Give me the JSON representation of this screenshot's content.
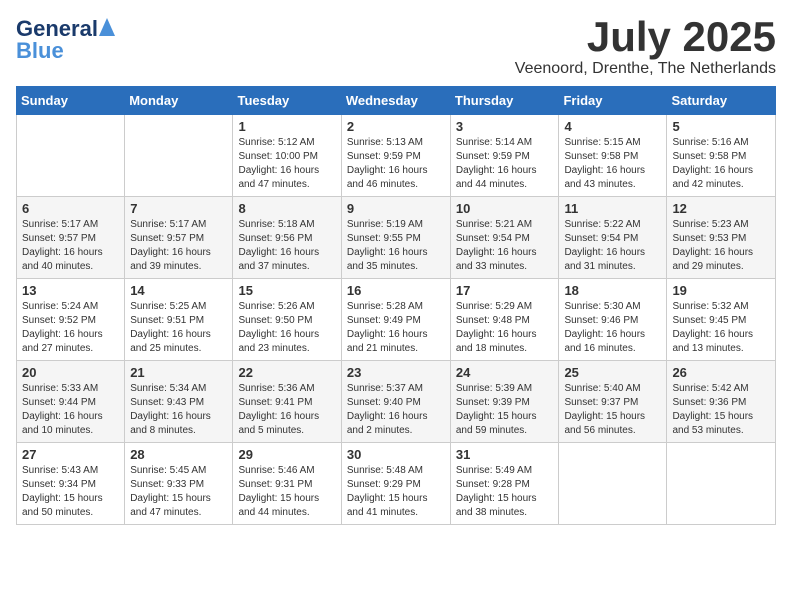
{
  "header": {
    "logo_general": "General",
    "logo_blue": "Blue",
    "month_title": "July 2025",
    "location": "Veenoord, Drenthe, The Netherlands"
  },
  "calendar": {
    "days_of_week": [
      "Sunday",
      "Monday",
      "Tuesday",
      "Wednesday",
      "Thursday",
      "Friday",
      "Saturday"
    ],
    "weeks": [
      [
        {
          "day": "",
          "info": ""
        },
        {
          "day": "",
          "info": ""
        },
        {
          "day": "1",
          "info": "Sunrise: 5:12 AM\nSunset: 10:00 PM\nDaylight: 16 hours\nand 47 minutes."
        },
        {
          "day": "2",
          "info": "Sunrise: 5:13 AM\nSunset: 9:59 PM\nDaylight: 16 hours\nand 46 minutes."
        },
        {
          "day": "3",
          "info": "Sunrise: 5:14 AM\nSunset: 9:59 PM\nDaylight: 16 hours\nand 44 minutes."
        },
        {
          "day": "4",
          "info": "Sunrise: 5:15 AM\nSunset: 9:58 PM\nDaylight: 16 hours\nand 43 minutes."
        },
        {
          "day": "5",
          "info": "Sunrise: 5:16 AM\nSunset: 9:58 PM\nDaylight: 16 hours\nand 42 minutes."
        }
      ],
      [
        {
          "day": "6",
          "info": "Sunrise: 5:17 AM\nSunset: 9:57 PM\nDaylight: 16 hours\nand 40 minutes."
        },
        {
          "day": "7",
          "info": "Sunrise: 5:17 AM\nSunset: 9:57 PM\nDaylight: 16 hours\nand 39 minutes."
        },
        {
          "day": "8",
          "info": "Sunrise: 5:18 AM\nSunset: 9:56 PM\nDaylight: 16 hours\nand 37 minutes."
        },
        {
          "day": "9",
          "info": "Sunrise: 5:19 AM\nSunset: 9:55 PM\nDaylight: 16 hours\nand 35 minutes."
        },
        {
          "day": "10",
          "info": "Sunrise: 5:21 AM\nSunset: 9:54 PM\nDaylight: 16 hours\nand 33 minutes."
        },
        {
          "day": "11",
          "info": "Sunrise: 5:22 AM\nSunset: 9:54 PM\nDaylight: 16 hours\nand 31 minutes."
        },
        {
          "day": "12",
          "info": "Sunrise: 5:23 AM\nSunset: 9:53 PM\nDaylight: 16 hours\nand 29 minutes."
        }
      ],
      [
        {
          "day": "13",
          "info": "Sunrise: 5:24 AM\nSunset: 9:52 PM\nDaylight: 16 hours\nand 27 minutes."
        },
        {
          "day": "14",
          "info": "Sunrise: 5:25 AM\nSunset: 9:51 PM\nDaylight: 16 hours\nand 25 minutes."
        },
        {
          "day": "15",
          "info": "Sunrise: 5:26 AM\nSunset: 9:50 PM\nDaylight: 16 hours\nand 23 minutes."
        },
        {
          "day": "16",
          "info": "Sunrise: 5:28 AM\nSunset: 9:49 PM\nDaylight: 16 hours\nand 21 minutes."
        },
        {
          "day": "17",
          "info": "Sunrise: 5:29 AM\nSunset: 9:48 PM\nDaylight: 16 hours\nand 18 minutes."
        },
        {
          "day": "18",
          "info": "Sunrise: 5:30 AM\nSunset: 9:46 PM\nDaylight: 16 hours\nand 16 minutes."
        },
        {
          "day": "19",
          "info": "Sunrise: 5:32 AM\nSunset: 9:45 PM\nDaylight: 16 hours\nand 13 minutes."
        }
      ],
      [
        {
          "day": "20",
          "info": "Sunrise: 5:33 AM\nSunset: 9:44 PM\nDaylight: 16 hours\nand 10 minutes."
        },
        {
          "day": "21",
          "info": "Sunrise: 5:34 AM\nSunset: 9:43 PM\nDaylight: 16 hours\nand 8 minutes."
        },
        {
          "day": "22",
          "info": "Sunrise: 5:36 AM\nSunset: 9:41 PM\nDaylight: 16 hours\nand 5 minutes."
        },
        {
          "day": "23",
          "info": "Sunrise: 5:37 AM\nSunset: 9:40 PM\nDaylight: 16 hours\nand 2 minutes."
        },
        {
          "day": "24",
          "info": "Sunrise: 5:39 AM\nSunset: 9:39 PM\nDaylight: 15 hours\nand 59 minutes."
        },
        {
          "day": "25",
          "info": "Sunrise: 5:40 AM\nSunset: 9:37 PM\nDaylight: 15 hours\nand 56 minutes."
        },
        {
          "day": "26",
          "info": "Sunrise: 5:42 AM\nSunset: 9:36 PM\nDaylight: 15 hours\nand 53 minutes."
        }
      ],
      [
        {
          "day": "27",
          "info": "Sunrise: 5:43 AM\nSunset: 9:34 PM\nDaylight: 15 hours\nand 50 minutes."
        },
        {
          "day": "28",
          "info": "Sunrise: 5:45 AM\nSunset: 9:33 PM\nDaylight: 15 hours\nand 47 minutes."
        },
        {
          "day": "29",
          "info": "Sunrise: 5:46 AM\nSunset: 9:31 PM\nDaylight: 15 hours\nand 44 minutes."
        },
        {
          "day": "30",
          "info": "Sunrise: 5:48 AM\nSunset: 9:29 PM\nDaylight: 15 hours\nand 41 minutes."
        },
        {
          "day": "31",
          "info": "Sunrise: 5:49 AM\nSunset: 9:28 PM\nDaylight: 15 hours\nand 38 minutes."
        },
        {
          "day": "",
          "info": ""
        },
        {
          "day": "",
          "info": ""
        }
      ]
    ]
  }
}
